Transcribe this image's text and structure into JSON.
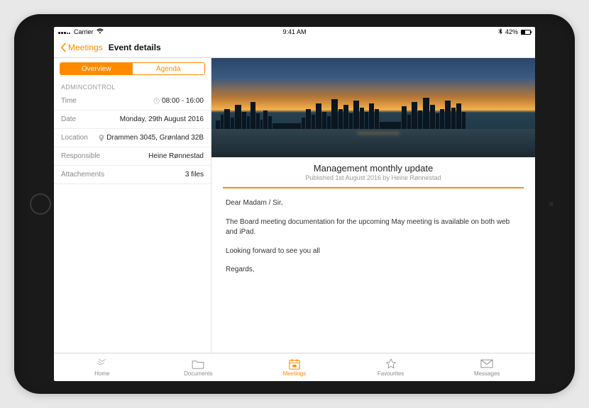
{
  "status": {
    "carrier": "Carrier",
    "time": "9:41 AM",
    "battery": "42%"
  },
  "nav": {
    "back": "Meetings",
    "title": "Event details"
  },
  "segments": {
    "overview": "Overview",
    "agenda": "Agenda"
  },
  "group_label": "ADMINCONTROL",
  "rows": {
    "time": {
      "label": "Time",
      "value": "08:00 - 16:00"
    },
    "date": {
      "label": "Date",
      "value": "Monday, 29th August 2016"
    },
    "location": {
      "label": "Location",
      "value": "Drammen 3045, Grønland 32B"
    },
    "responsible": {
      "label": "Responsible",
      "value": "Heine Rønnestad"
    },
    "attachments": {
      "label": "Attachements",
      "value": "3 files"
    }
  },
  "doc": {
    "title": "Management monthly update",
    "subtitle": "Published 1st August 2016 by Heine Rønnestad",
    "p1": "Dear Madam / Sir,",
    "p2": "The Board meeting documentation for the upcoming May meeting is available on both web and iPad.",
    "p3": "Looking forward to see you all",
    "p4": "Regards,"
  },
  "tabs": {
    "home": "Home",
    "documents": "Documents",
    "meetings": "Meetings",
    "favourites": "Favourites",
    "messages": "Messages"
  },
  "colors": {
    "accent": "#ff8a00"
  }
}
